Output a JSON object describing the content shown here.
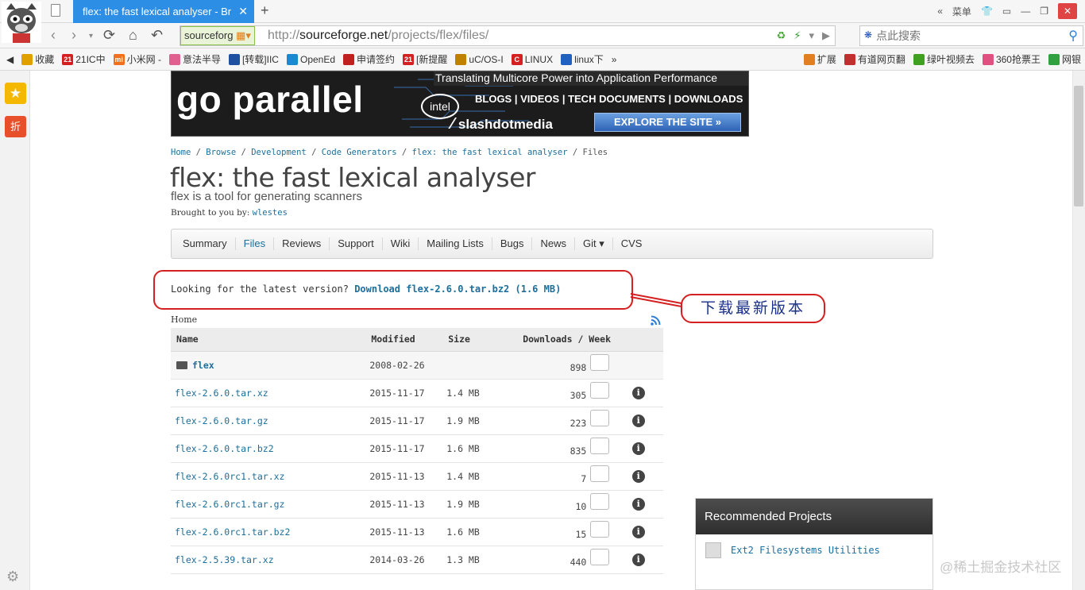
{
  "browser": {
    "tab_title": "flex: the fast lexical analyser - Br",
    "tab_close": "✕",
    "new_tab": "+",
    "menu_label": "菜单",
    "site_badge": "sourceforg",
    "url_host": "http://sourceforge.net",
    "url_path": "/projects/flex/files/",
    "search_placeholder": "点此搜索"
  },
  "bookmarks": [
    {
      "icon": "star-icon",
      "label": "收藏",
      "color": "#e0a000"
    },
    {
      "icon": "21ic-icon",
      "label": "21IC中",
      "color": "#d42020",
      "text": "21"
    },
    {
      "icon": "mi-icon",
      "label": "小米网 -",
      "color": "#f07020",
      "text": "mi"
    },
    {
      "icon": "flower-icon",
      "label": "意法半导",
      "color": "#e06090"
    },
    {
      "icon": "puzzle-icon",
      "label": "[转载]IIC",
      "color": "#2050a0"
    },
    {
      "icon": "openedv-icon",
      "label": "OpenEd",
      "color": "#1a8ad0"
    },
    {
      "icon": "circle-icon",
      "label": "申请签约",
      "color": "#c02020"
    },
    {
      "icon": "21-icon",
      "label": "[新提醒",
      "color": "#d42020",
      "text": "21"
    },
    {
      "icon": "ucos-icon",
      "label": "uC/OS-I",
      "color": "#c08000"
    },
    {
      "icon": "c-icon",
      "label": "LINUX",
      "color": "#d42020",
      "text": "C"
    },
    {
      "icon": "paw-icon",
      "label": "linux下",
      "color": "#2060c0"
    },
    {
      "icon": "more-icon",
      "label": "»",
      "color": ""
    },
    {
      "icon": "grid-icon",
      "label": "扩展",
      "color": "#e08020"
    },
    {
      "icon": "youdao-icon",
      "label": "有道网页翻",
      "color": "#c03030"
    },
    {
      "icon": "video-icon",
      "label": "绿叶视频去",
      "color": "#40a020"
    },
    {
      "icon": "ticket-icon",
      "label": "360抢票王",
      "color": "#e05080"
    },
    {
      "icon": "yen-icon",
      "label": "网银",
      "color": "#30a040"
    }
  ],
  "banner": {
    "tagline": "Translating Multicore Power into Application Performance",
    "headline": "go parallel",
    "intel": "intel",
    "links": "BLOGS | VIDEOS | TECH DOCUMENTS | DOWNLOADS",
    "brand": "slashdotmedia",
    "cta": "EXPLORE THE SITE »"
  },
  "breadcrumb": {
    "home": "Home",
    "browse": "Browse",
    "development": "Development",
    "codegen": "Code Generators",
    "project": "flex: the fast lexical analyser",
    "current": "Files",
    "sep": "/"
  },
  "project": {
    "title": "flex: the fast lexical analyser",
    "subtitle": "flex is a tool for generating scanners",
    "brought_label": "Brought to you by:",
    "author": "wlestes"
  },
  "tabs": [
    "Summary",
    "Files",
    "Reviews",
    "Support",
    "Wiki",
    "Mailing Lists",
    "Bugs",
    "News",
    "Git ▾",
    "CVS"
  ],
  "latest": {
    "prefix": "Looking for the latest version?",
    "link": "Download flex-2.6.0.tar.bz2 (1.6 MB)"
  },
  "annotation": "下载最新版本",
  "files": {
    "path_label": "Home",
    "headers": {
      "name": "Name",
      "modified": "Modified",
      "size": "Size",
      "downloads": "Downloads / Week"
    },
    "rows": [
      {
        "name": "flex",
        "modified": "2008-02-26",
        "size": "",
        "downloads": "898",
        "folder": true
      },
      {
        "name": "flex-2.6.0.tar.xz",
        "modified": "2015-11-17",
        "size": "1.4 MB",
        "downloads": "305"
      },
      {
        "name": "flex-2.6.0.tar.gz",
        "modified": "2015-11-17",
        "size": "1.9 MB",
        "downloads": "223"
      },
      {
        "name": "flex-2.6.0.tar.bz2",
        "modified": "2015-11-17",
        "size": "1.6 MB",
        "downloads": "835"
      },
      {
        "name": "flex-2.6.0rc1.tar.xz",
        "modified": "2015-11-13",
        "size": "1.4 MB",
        "downloads": "7"
      },
      {
        "name": "flex-2.6.0rc1.tar.gz",
        "modified": "2015-11-13",
        "size": "1.9 MB",
        "downloads": "10"
      },
      {
        "name": "flex-2.6.0rc1.tar.bz2",
        "modified": "2015-11-13",
        "size": "1.6 MB",
        "downloads": "15"
      },
      {
        "name": "flex-2.5.39.tar.xz",
        "modified": "2014-03-26",
        "size": "1.3 MB",
        "downloads": "440"
      }
    ]
  },
  "recommended": {
    "heading": "Recommended Projects",
    "item": "Ext2 Filesystems Utilities"
  },
  "watermark": "@稀土掘金技术社区"
}
